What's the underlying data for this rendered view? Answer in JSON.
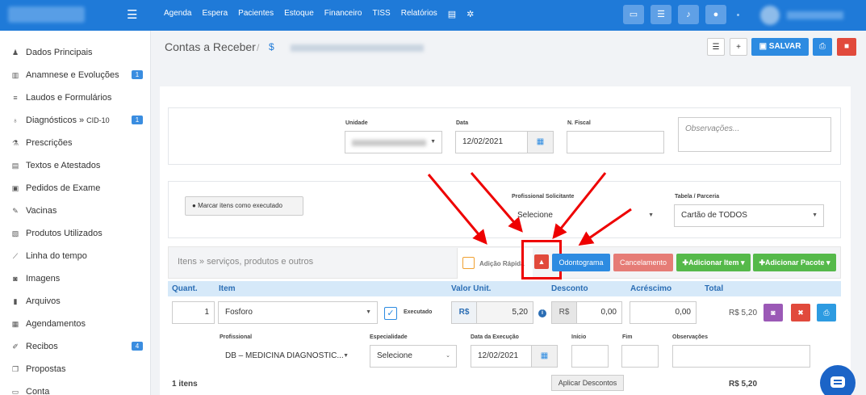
{
  "topnav": {
    "items": [
      "Agenda",
      "Espera",
      "Pacientes",
      "Estoque",
      "Financeiro",
      "TISS",
      "Relatórios"
    ]
  },
  "sidebar": {
    "items": [
      {
        "label": "Dados Principais",
        "icon": "user-icon"
      },
      {
        "label": "Anamnese e Evoluções",
        "icon": "chart-icon",
        "badge": "1"
      },
      {
        "label": "Laudos e Formulários",
        "icon": "list-icon"
      },
      {
        "label": "Diagnósticos »",
        "small": "CID-10",
        "icon": "stethoscope-icon",
        "badge": "1"
      },
      {
        "label": "Prescrições",
        "icon": "flask-icon"
      },
      {
        "label": "Textos e Atestados",
        "icon": "document-icon"
      },
      {
        "label": "Pedidos de Exame",
        "icon": "clipboard-icon"
      },
      {
        "label": "Vacinas",
        "icon": "syringe-icon"
      },
      {
        "label": "Produtos Utilizados",
        "icon": "camera-icon"
      },
      {
        "label": "Linha do tempo",
        "icon": "line-chart-icon"
      },
      {
        "label": "Imagens",
        "icon": "image-icon"
      },
      {
        "label": "Arquivos",
        "icon": "file-icon"
      },
      {
        "label": "Agendamentos",
        "icon": "calendar-icon"
      },
      {
        "label": "Recibos",
        "icon": "edit-icon",
        "badge": "4"
      },
      {
        "label": "Propostas",
        "icon": "copy-icon"
      },
      {
        "label": "Conta",
        "icon": "money-icon"
      }
    ]
  },
  "header": {
    "title": "Contas a Receber",
    "separator": "/",
    "dollar": "$",
    "save_label": "SALVAR"
  },
  "form": {
    "unidade_label": "Unidade",
    "data_label": "Data",
    "data_value": "12/02/2021",
    "nfiscal_label": "N. Fiscal",
    "observacoes_placeholder": "Observações...",
    "marcar_label": "Marcar itens como executado",
    "prof_solicitante_label": "Profissional Solicitante",
    "prof_solicitante_value": "Selecione",
    "tabela_label": "Tabela / Parceria",
    "tabela_value": "Cartão de TODOS"
  },
  "items": {
    "title": "Itens » serviços, produtos e outros",
    "adicao_label": "Adição Rápida",
    "odontograma_label": "Odontograma",
    "cancelamento_label": "Cancelamento",
    "adicionar_item_label": "Adicionar Item",
    "adicionar_pacote_label": "Adicionar Pacote",
    "columns": [
      "Quant.",
      "Item",
      "Valor Unit.",
      "Desconto",
      "Acréscimo",
      "Total"
    ],
    "row": {
      "quant": "1",
      "item": "Fosforo",
      "executado": "Executado",
      "currency": "R$",
      "valor": "5,20",
      "desconto": "0,00",
      "acrescimo": "0,00",
      "total": "R$ 5,20"
    },
    "detail_labels": [
      "Profissional",
      "Especialidade",
      "Data da Execução",
      "Início",
      "Fim",
      "Observações"
    ],
    "detail": {
      "profissional": "DB – MEDICINA DIAGNOSTIC...",
      "especialidade": "Selecione",
      "data_execucao": "12/02/2021"
    },
    "footer_count": "1 itens",
    "aplicar_label": "Aplicar Descontos",
    "footer_total": "R$ 5,20"
  }
}
